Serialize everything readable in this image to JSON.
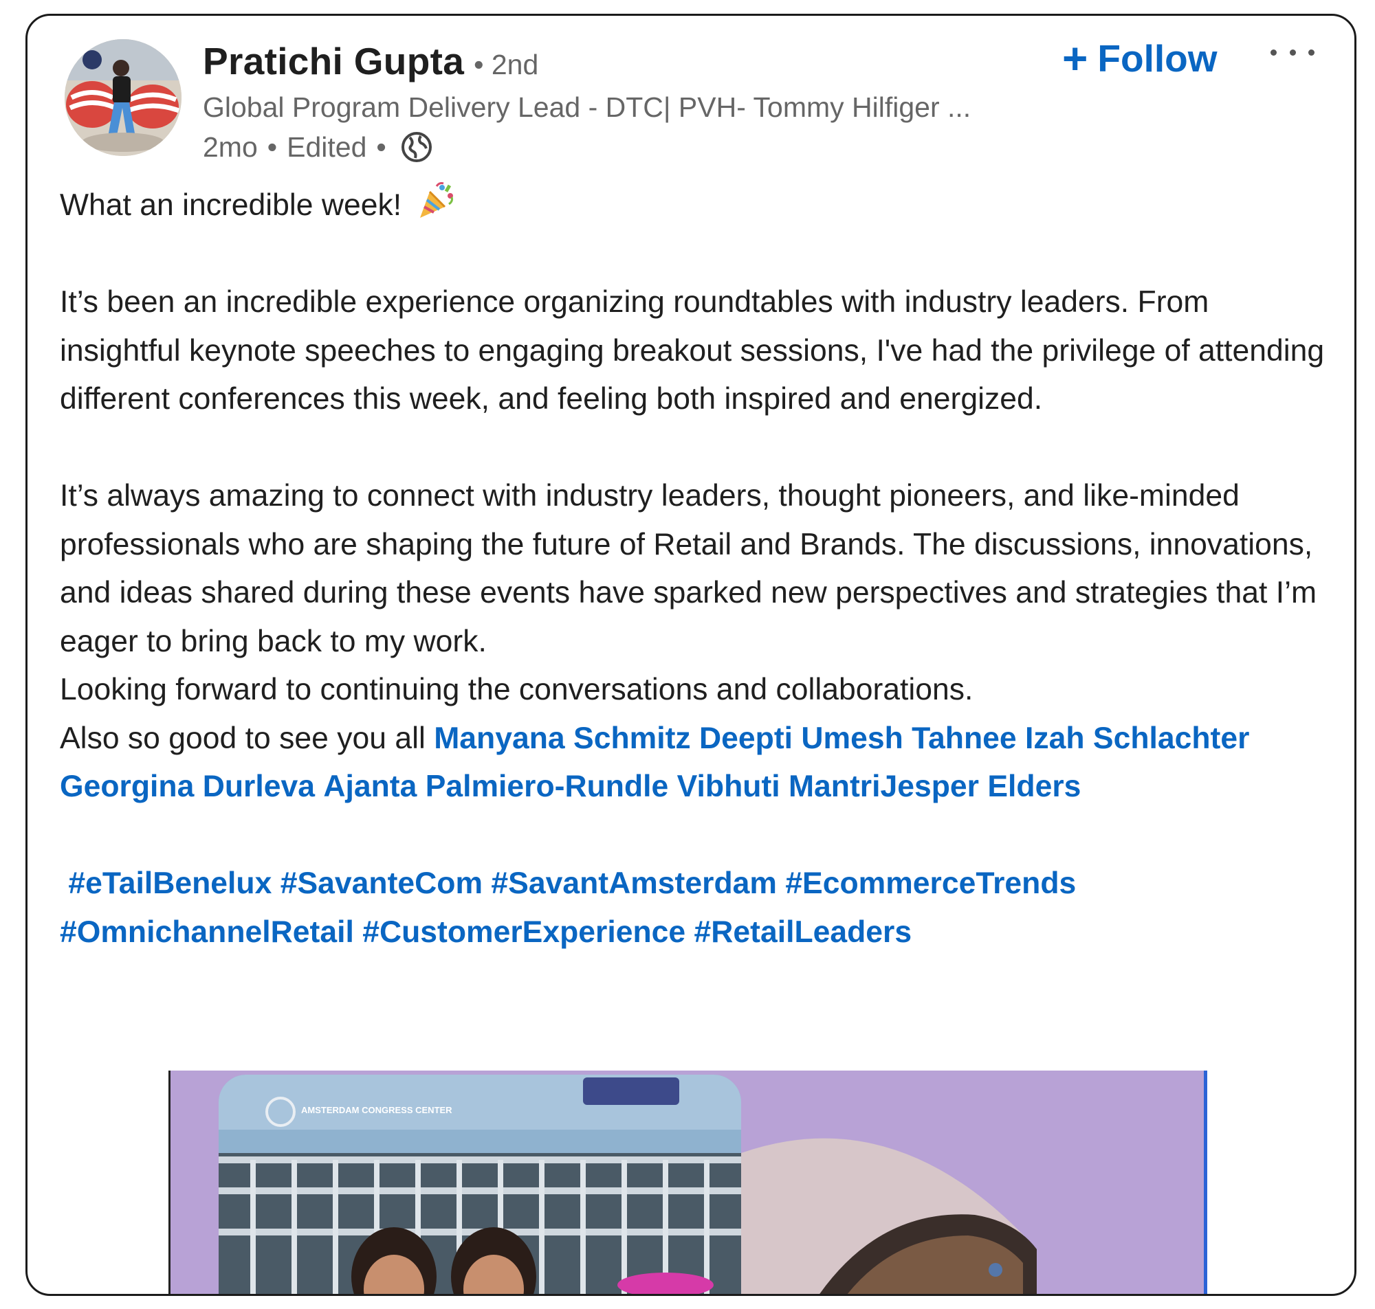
{
  "post": {
    "author": {
      "name": "Pratichi Gupta",
      "degree": "• 2nd",
      "headline": "Global Program Delivery Lead - DTC| PVH- Tommy Hilfiger ...",
      "time": "2mo",
      "edited": "Edited",
      "sep": "•",
      "visibility_icon": "globe-icon"
    },
    "follow_label": "Follow",
    "follow_icon": "+",
    "more_icon": "ellipsis-icon",
    "text": {
      "line1": "What an incredible week!",
      "line1_emoji": "party-popper",
      "para2": "It’s been an incredible experience organizing roundtables with industry leaders. From insightful keynote speeches to engaging breakout sessions, I've had the privilege of attending different conferences this week, and feeling both inspired and energized.",
      "para3": "It’s always amazing to connect with industry leaders, thought pioneers, and like-minded professionals who are shaping the future of Retail and Brands. The discussions, innovations, and ideas shared during these events have sparked new perspectives and strategies that I’m eager to bring back to my work.",
      "para4": "Looking forward to continuing the conversations and collaborations.",
      "mentions_intro": "Also so good to see you all ",
      "mentions": [
        "Manyana Schmitz",
        "Deepti Umesh",
        "Tahnee Izah Schlachter",
        "Georgina Durleva",
        "Ajanta Palmiero-Rundle",
        "Vibhuti Mantri",
        "Jesper Elders"
      ],
      "hashtags": [
        "#eTailBenelux",
        "#SavanteCom",
        "#SavantAmsterdam",
        "#EcommerceTrends",
        "#OmnichannelRetail",
        "#CustomerExperience",
        "#RetailLeaders"
      ]
    },
    "media": {
      "building_sign": "AMSTERDAM CONGRESS CENTER"
    },
    "colors": {
      "link": "#0a66c2",
      "text": "#1f1f1f",
      "muted": "#666666",
      "media_bg": "#b8a2d6"
    }
  }
}
